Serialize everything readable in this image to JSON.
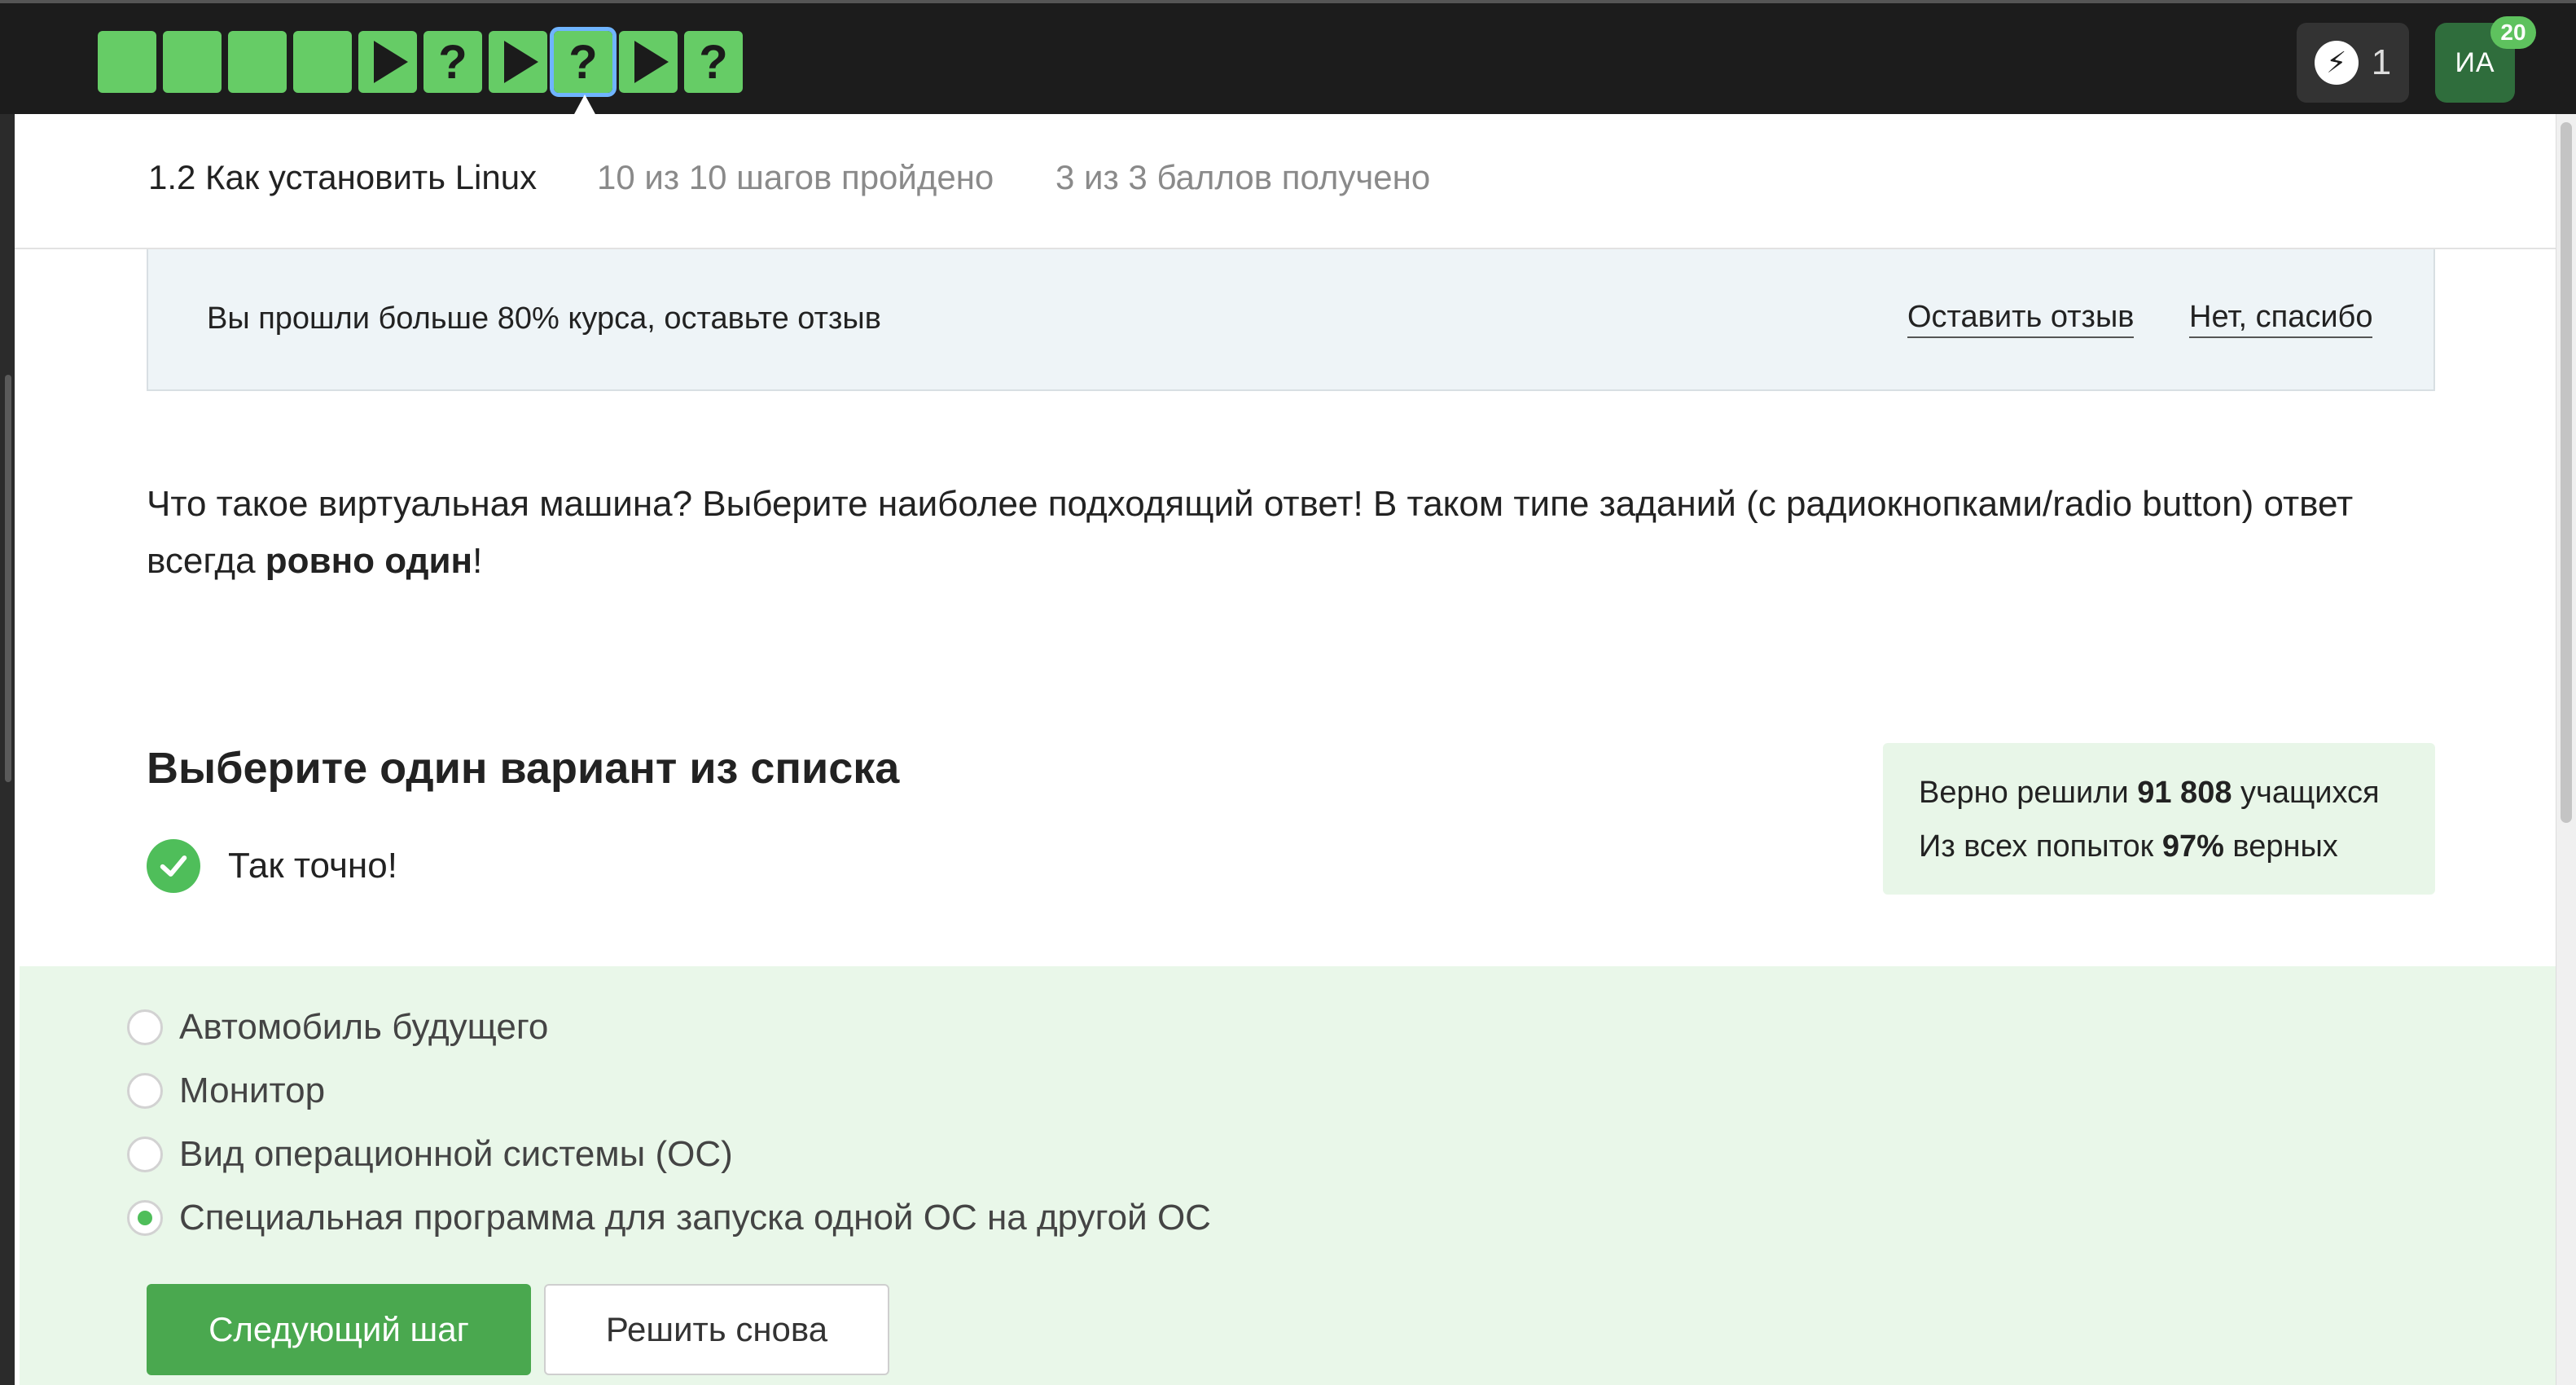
{
  "topbar": {
    "steps": [
      {
        "state": "done-text",
        "glyph": ""
      },
      {
        "state": "done-text",
        "glyph": ""
      },
      {
        "state": "done-text",
        "glyph": ""
      },
      {
        "state": "done-text",
        "glyph": ""
      },
      {
        "state": "video",
        "glyph": "play-icon"
      },
      {
        "state": "quiz",
        "glyph": "?"
      },
      {
        "state": "video",
        "glyph": "play-icon"
      },
      {
        "state": "quiz-current",
        "glyph": "?"
      },
      {
        "state": "video",
        "glyph": "play-icon"
      },
      {
        "state": "quiz",
        "glyph": "?"
      }
    ],
    "energy_count": "1",
    "avatar_initials": "ИА",
    "avatar_badge": "20",
    "step_color": "#66cc66",
    "current_outline_color": "#6fb4ff"
  },
  "lesson": {
    "title": "1.2 Как установить Linux",
    "steps_done": "10 из 10 шагов пройдено",
    "points": "3 из 3 баллов  получено"
  },
  "feedback": {
    "message": "Вы прошли больше 80% курса, оставьте отзыв",
    "leave_label": "Оставить отзыв",
    "decline_label": "Нет, спасибо"
  },
  "question": {
    "text_before": "Что такое виртуальная машина? Выберите наиболее подходящий ответ! В таком типе заданий (с радиокнопками/radio button) ответ всегда ",
    "text_bold": "ровно один",
    "text_after": "!"
  },
  "quiz": {
    "title": "Выберите один вариант из списка",
    "result": "Так точно!",
    "stats": {
      "line1_prefix": "Верно решили ",
      "line1_value": "91 808",
      "line1_suffix": " учащихся",
      "line2_prefix": "Из всех попыток ",
      "line2_value": "97%",
      "line2_suffix": " верных"
    },
    "options": [
      {
        "label": "Автомобиль будущего",
        "selected": false
      },
      {
        "label": "Монитор",
        "selected": false
      },
      {
        "label": "Вид операционной системы (ОС)",
        "selected": false
      },
      {
        "label": "Специальная программа для запуска одной ОС на другой ОС",
        "selected": true
      }
    ],
    "next_label": "Следующий шаг",
    "retry_label": "Решить снова",
    "accent_color": "#4aa84f"
  }
}
